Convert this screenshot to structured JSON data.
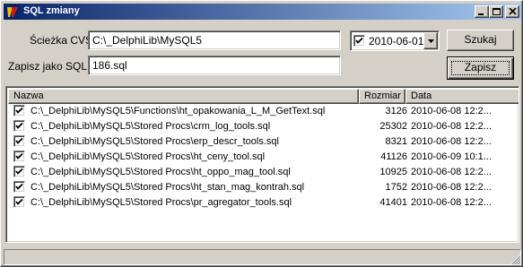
{
  "window": {
    "title": "SQL zmiany"
  },
  "form": {
    "cvs_path_label": "Ścieżka CVS:",
    "cvs_path_value": "C:\\_DelphiLib\\MySQL5",
    "save_as_label": "Zapisz jako SQL:",
    "save_as_value": "186.sql",
    "date_checked": true,
    "date_value": "2010-06-01",
    "search_button": "Szukaj",
    "save_button": "Zapisz"
  },
  "table": {
    "columns": [
      "Nazwa",
      "Rozmiar",
      "Data"
    ],
    "rows": [
      {
        "checked": true,
        "name": "C:\\_DelphiLib\\MySQL5\\Functions\\ht_opakowania_L_M_GetText.sql",
        "size": "3126",
        "date": "2010-06-08 12:2..."
      },
      {
        "checked": true,
        "name": "C:\\_DelphiLib\\MySQL5\\Stored Procs\\crm_log_tools.sql",
        "size": "25302",
        "date": "2010-06-08 12:2..."
      },
      {
        "checked": true,
        "name": "C:\\_DelphiLib\\MySQL5\\Stored Procs\\erp_descr_tools.sql",
        "size": "8321",
        "date": "2010-06-08 12:2..."
      },
      {
        "checked": true,
        "name": "C:\\_DelphiLib\\MySQL5\\Stored Procs\\ht_ceny_tool.sql",
        "size": "41126",
        "date": "2010-06-09 10:1..."
      },
      {
        "checked": true,
        "name": "C:\\_DelphiLib\\MySQL5\\Stored Procs\\ht_oppo_mag_tool.sql",
        "size": "10925",
        "date": "2010-06-08 12:2..."
      },
      {
        "checked": true,
        "name": "C:\\_DelphiLib\\MySQL5\\Stored Procs\\ht_stan_mag_kontrah.sql",
        "size": "1752",
        "date": "2010-06-08 12:2..."
      },
      {
        "checked": true,
        "name": "C:\\_DelphiLib\\MySQL5\\Stored Procs\\pr_agregator_tools.sql",
        "size": "41401",
        "date": "2010-06-08 12:2..."
      }
    ]
  },
  "colors": {
    "title_active_start": "#0a246a",
    "title_active_end": "#a6caf0",
    "face": "#d4d0c8"
  }
}
